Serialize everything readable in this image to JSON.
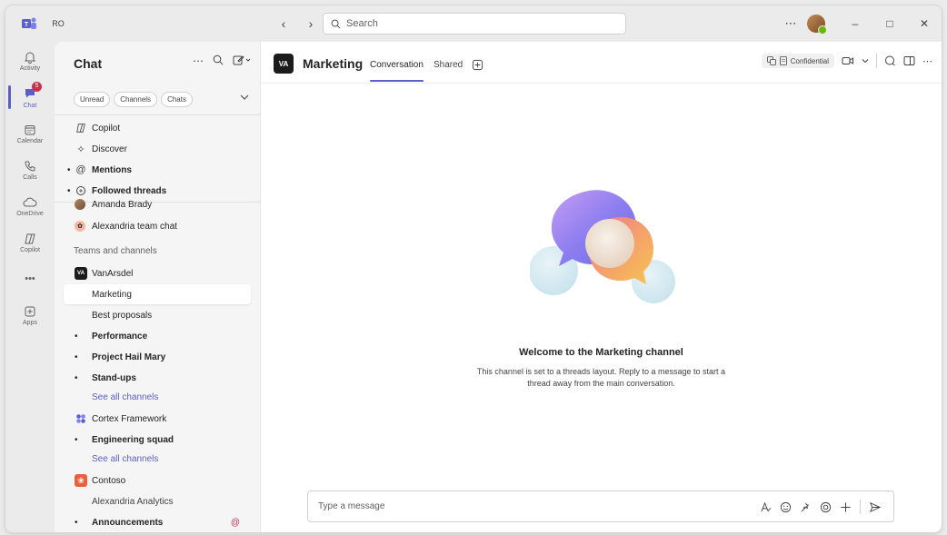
{
  "titlebar": {
    "initials": "RO",
    "search_placeholder": "Search",
    "more": "⋯",
    "back": "‹",
    "forward": "›",
    "minimize": "–",
    "maximize": "□",
    "close": "✕"
  },
  "rail": {
    "items": [
      {
        "label": "Activity",
        "icon": "bell-icon"
      },
      {
        "label": "Chat",
        "icon": "chat-icon",
        "badge": "5"
      },
      {
        "label": "Calendar",
        "icon": "calendar-icon"
      },
      {
        "label": "Calls",
        "icon": "phone-icon"
      },
      {
        "label": "OneDrive",
        "icon": "cloud-icon"
      },
      {
        "label": "Copilot",
        "icon": "copilot-icon"
      },
      {
        "label": "•••",
        "icon": "more-icon"
      },
      {
        "label": "Apps",
        "icon": "apps-icon"
      }
    ]
  },
  "panel": {
    "title": "Chat",
    "filters": [
      "Unread",
      "Channels",
      "Chats"
    ],
    "items": {
      "copilot": "Copilot",
      "discover": "Discover",
      "mentions": "Mentions",
      "followed": "Followed threads",
      "amanda": "Amanda Brady",
      "alexandria_chat": "Alexandria team chat",
      "teams_section": "Teams and channels",
      "vanarsdel": "VanArsdel",
      "marketing": "Marketing",
      "best_proposals": "Best proposals",
      "performance": "Performance",
      "project_hail_mary": "Project Hail Mary",
      "standups": "Stand-ups",
      "see_all_1": "See all channels",
      "cortex": "Cortex Framework",
      "engineering": "Engineering squad",
      "see_all_2": "See all channels",
      "contoso": "Contoso",
      "alexandria_analytics": "Alexandria Analytics",
      "announcements": "Announcements"
    },
    "team_logos": {
      "vanarsdel": "VA",
      "contoso": "❀"
    }
  },
  "channel": {
    "logo": "VA",
    "name": "Marketing",
    "tabs": [
      "Conversation",
      "Shared"
    ],
    "sensitivity": "Confidential"
  },
  "welcome": {
    "title": "Welcome to the Marketing channel",
    "subtitle": "This channel is set to a threads layout. Reply to a message to start a thread away from the main conversation."
  },
  "composer": {
    "placeholder": "Type a message"
  },
  "colors": {
    "accent": "#5b5fc7",
    "badge": "#c4314b",
    "presence": "#6bb700"
  }
}
